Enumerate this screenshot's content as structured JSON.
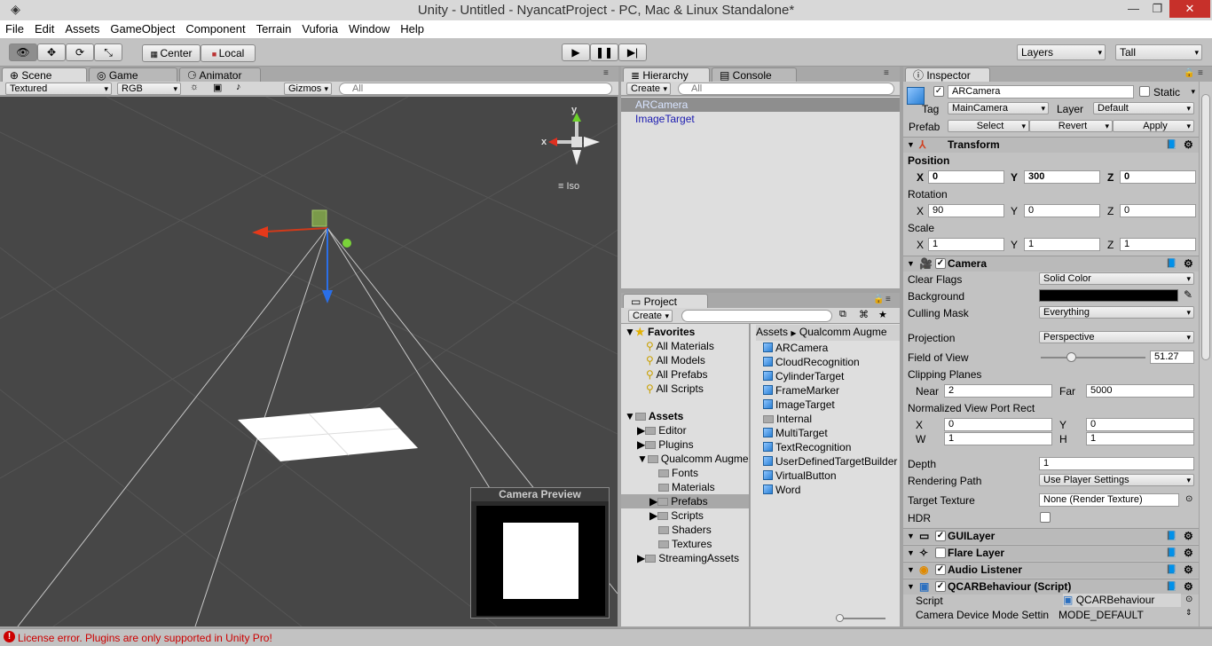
{
  "window": {
    "title": "Unity - Untitled - NyancatProject - PC, Mac & Linux Standalone*"
  },
  "menu": [
    "File",
    "Edit",
    "Assets",
    "GameObject",
    "Component",
    "Terrain",
    "Vuforia",
    "Window",
    "Help"
  ],
  "toolbar": {
    "pivot": "Center",
    "space": "Local",
    "layers": "Layers",
    "layout": "Tall"
  },
  "scene": {
    "tabs": [
      "Scene",
      "Game",
      "Animator"
    ],
    "render_mode": "Textured",
    "color_mode": "RGB",
    "gizmos": "Gizmos",
    "search_placeholder": "All",
    "gizmo_x": "x",
    "gizmo_y": "y",
    "iso_label": "Iso",
    "camera_preview_title": "Camera Preview"
  },
  "hierarchy": {
    "tabs": [
      "Hierarchy",
      "Console"
    ],
    "create": "Create",
    "search_placeholder": "All",
    "items": [
      "ARCamera",
      "ImageTarget"
    ]
  },
  "project": {
    "tab": "Project",
    "create": "Create",
    "breadcrumb": [
      "Assets",
      "Qualcomm Augme"
    ],
    "favorites_label": "Favorites",
    "favorites": [
      "All Materials",
      "All Models",
      "All Prefabs",
      "All Scripts"
    ],
    "assets_label": "Assets",
    "tree": [
      "Editor",
      "Plugins",
      "Qualcomm Augme",
      "Fonts",
      "Materials",
      "Prefabs",
      "Scripts",
      "Shaders",
      "Textures",
      "StreamingAssets"
    ],
    "prefabs": [
      "ARCamera",
      "CloudRecognition",
      "CylinderTarget",
      "FrameMarker",
      "ImageTarget",
      "Internal",
      "MultiTarget",
      "TextRecognition",
      "UserDefinedTargetBuilder",
      "VirtualButton",
      "Word"
    ]
  },
  "inspector": {
    "tab": "Inspector",
    "name": "ARCamera",
    "static_label": "Static",
    "tag_label": "Tag",
    "tag": "MainCamera",
    "layer_label": "Layer",
    "layer": "Default",
    "prefab_label": "Prefab",
    "prefab_buttons": [
      "Select",
      "Revert",
      "Apply"
    ],
    "transform": {
      "title": "Transform",
      "position_label": "Position",
      "position": [
        "0",
        "300",
        "0"
      ],
      "rotation_label": "Rotation",
      "rotation": [
        "90",
        "0",
        "0"
      ],
      "scale_label": "Scale",
      "scale": [
        "1",
        "1",
        "1"
      ],
      "axes": [
        "X",
        "Y",
        "Z"
      ]
    },
    "camera": {
      "title": "Camera",
      "clear_flags_label": "Clear Flags",
      "clear_flags": "Solid Color",
      "background_label": "Background",
      "background_color": "#000000",
      "culling_mask_label": "Culling Mask",
      "culling_mask": "Everything",
      "projection_label": "Projection",
      "projection": "Perspective",
      "fov_label": "Field of View",
      "fov": "51.27",
      "fov_fraction": 0.285,
      "clipping_label": "Clipping Planes",
      "near_label": "Near",
      "near": "2",
      "far_label": "Far",
      "far": "5000",
      "viewport_label": "Normalized View Port Rect",
      "viewport_labels": [
        "X",
        "Y",
        "W",
        "H"
      ],
      "viewport": [
        "0",
        "0",
        "1",
        "1"
      ],
      "depth_label": "Depth",
      "depth": "1",
      "rendering_path_label": "Rendering Path",
      "rendering_path": "Use Player Settings",
      "target_texture_label": "Target Texture",
      "target_texture": "None (Render Texture)",
      "hdr_label": "HDR"
    },
    "components": [
      "GUILayer",
      "Flare Layer",
      "Audio Listener",
      "QCARBehaviour (Script)"
    ],
    "qcar": {
      "script_label": "Script",
      "script": "QCARBehaviour",
      "mode_label": "Camera Device Mode Settin",
      "mode": "MODE_DEFAULT"
    }
  },
  "status": {
    "message": "License error. Plugins are only supported in Unity Pro!",
    "error_color": "#cc0000"
  }
}
